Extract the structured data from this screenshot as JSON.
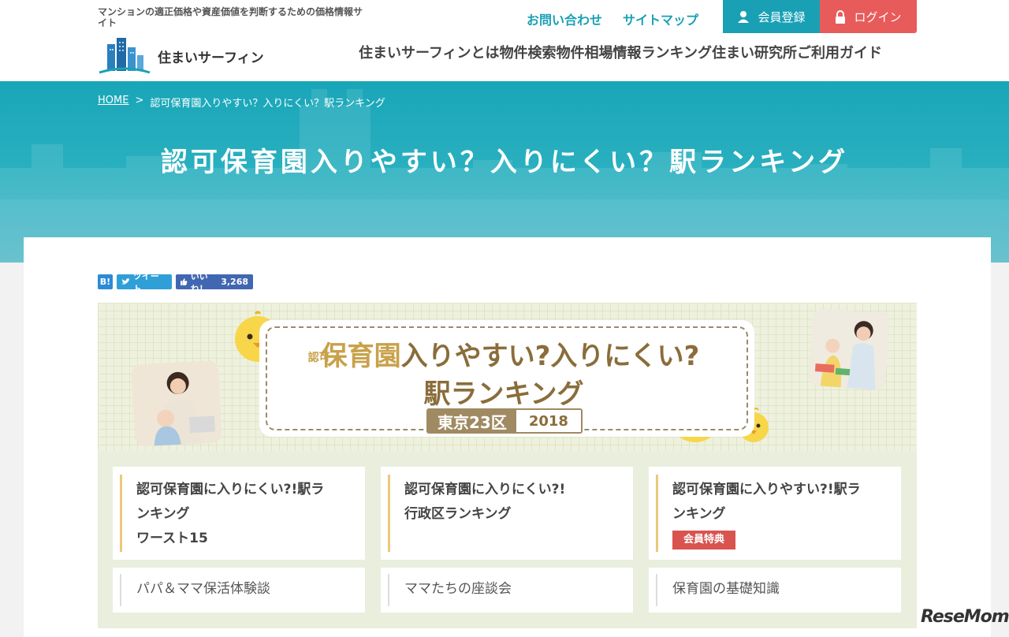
{
  "header": {
    "tagline": "マンションの適正価格や資産価値を判断するための価格情報サイト",
    "logo_text": "住まいサーフィン",
    "top_links": [
      "お問い合わせ",
      "サイトマップ"
    ],
    "register_label": "会員登録",
    "login_label": "ログイン",
    "nav": [
      "住まいサーフィンとは",
      "物件検索",
      "物件相場情報",
      "ランキング",
      "住まい研究所",
      "ご利用ガイド"
    ]
  },
  "breadcrumb": {
    "home": "HOME",
    "sep": ">",
    "current": "認可保育園入りやすい？入りにくい？駅ランキング"
  },
  "page_title": "認可保育園入りやすい？入りにくい？駅ランキング",
  "social": {
    "hatena": "B!",
    "tweet": "ツイート",
    "like": "いいね！",
    "like_count": "3,268"
  },
  "banner": {
    "prefix": "認可",
    "line1_gold": "保育園",
    "line1_rest": "入りやすい?入りにくい?",
    "line2": "駅ランキング",
    "area": "東京23区",
    "year": "2018"
  },
  "items": [
    {
      "line1": "認可保育園に入りにくい?!駅ラ",
      "line2": "ンキング",
      "line3": "ワースト15"
    },
    {
      "line1": "認可保育園に入りにくい?!",
      "line2": "行政区ランキング",
      "line3": ""
    },
    {
      "line1": "認可保育園に入りやすい?!駅ラ",
      "line2": "ンキング",
      "badge": "会員特典"
    }
  ],
  "sub_items": [
    "パパ＆ママ保活体験談",
    "ママたちの座談会",
    "保育園の基礎知識"
  ],
  "watermark": "ReseMom",
  "colors": {
    "teal": "#1aa0b5",
    "login_red": "#e85b5b",
    "badge_red": "#d9534f",
    "gold": "#c8a14a"
  }
}
